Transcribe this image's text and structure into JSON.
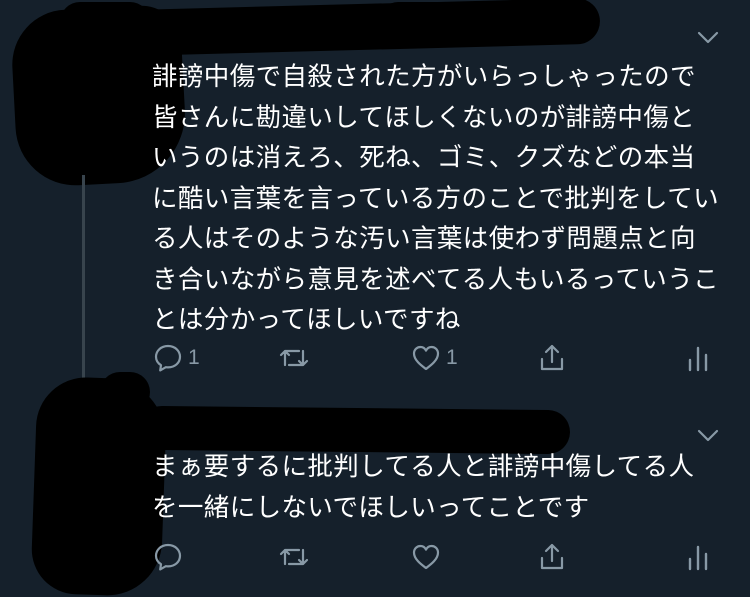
{
  "theme": {
    "background": "#15202b",
    "text": "#ffffff",
    "muted": "#8899a6",
    "thread_line": "#38444d",
    "redaction": "#000000"
  },
  "tweets": [
    {
      "author_redacted": true,
      "text": "誹謗中傷で自殺された方がいらっしゃったので皆さんに勘違いしてほしくないのが誹謗中傷というのは消えろ、死ね、ゴミ、クズなどの本当に酷い言葉を言っている方のことで批判をしている人はそのような汚い言葉は使わず問題点と向き合いながら意見を述べてる人もいるっていうことは分かってほしいですね",
      "actions": {
        "reply_icon": "reply-icon",
        "reply_count": "1",
        "retweet_icon": "retweet-icon",
        "retweet_count": "",
        "like_icon": "heart-icon",
        "like_count": "1",
        "share_icon": "share-icon",
        "stats_icon": "analytics-icon"
      }
    },
    {
      "author_redacted": true,
      "text": "まぁ要するに批判してる人と誹謗中傷してる人を一緒にしないでほしいってことです",
      "actions": {
        "reply_icon": "reply-icon",
        "reply_count": "",
        "retweet_icon": "retweet-icon",
        "retweet_count": "",
        "like_icon": "heart-icon",
        "like_count": "",
        "share_icon": "share-icon",
        "stats_icon": "analytics-icon"
      }
    }
  ]
}
